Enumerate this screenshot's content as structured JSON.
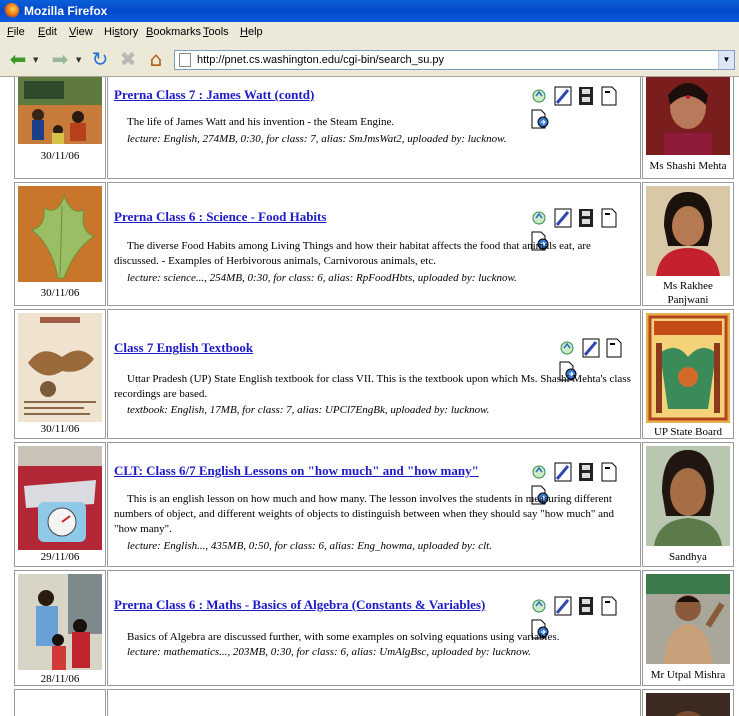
{
  "window": {
    "title": "Mozilla Firefox"
  },
  "menu": [
    {
      "label": "File",
      "key": "F",
      "rest": "ile"
    },
    {
      "label": "Edit",
      "key": "E",
      "rest": "dit"
    },
    {
      "label": "View",
      "key": "V",
      "rest": "iew"
    },
    {
      "label": "History",
      "key": "",
      "pre": "Hi",
      "key2": "s",
      "rest": "tory"
    },
    {
      "label": "Bookmarks",
      "key": "B",
      "rest": "ookmarks"
    },
    {
      "label": "Tools",
      "key": "T",
      "rest": "ools"
    },
    {
      "label": "Help",
      "key": "H",
      "rest": "elp"
    }
  ],
  "urlbar": {
    "url": "http://pnet.cs.washington.edu/cgi-bin/search_su.py"
  },
  "rows": [
    {
      "date": "30/11/06",
      "title": "Prerna Class 7 : James Watt (contd)",
      "description": "The life of James Watt and his invention - the Steam Engine.",
      "meta": "lecture: English, 274MB, 0:30, for class: 7, alias: SmJmsWat2, uploaded by: lucknow.",
      "person": "Ms Shashi Mehta",
      "has_video": true
    },
    {
      "date": "30/11/06",
      "title": "Prerna Class 6 : Science - Food Habits",
      "description": "The diverse Food Habits among Living Things and how their habitat affects the food that animals eat, are discussed. - Examples of Herbivorous animals, Carnivorous animals, etc.",
      "meta": "lecture: science..., 254MB, 0:30, for class: 6, alias: RpFoodHbts, uploaded by: lucknow.",
      "person": "Ms Rakhee Panjwani",
      "has_video": true
    },
    {
      "date": "30/11/06",
      "title": "Class 7 English Textbook",
      "description": "Uttar Pradesh (UP) State English textbook for class VII. This is the textbook upon which Ms. Shashi Mehta's class recordings are based.",
      "meta": "textbook: English, 17MB, for class: 7, alias: UPCl7EngBk, uploaded by: lucknow.",
      "person": "UP State Board",
      "has_video": false
    },
    {
      "date": "29/11/06",
      "title": "CLT: Class 6/7 English Lessons on \"how much\" and \"how many\"",
      "description": "This is an english lesson on how much and how many. The lesson involves the students in measuring different numbers of object, and different weights of objects to distinguish between when they should say \"how much\" and \"how many\".",
      "meta": "lecture: English..., 435MB, 0:50, for class: 6, alias: Eng_howma, uploaded by: clt.",
      "person": "Sandhya",
      "has_video": true
    },
    {
      "date": "28/11/06",
      "title": "Prerna Class 6 : Maths - Basics of Algebra (Constants & Variables)",
      "description": "Basics of Algebra are discussed further, with some examples on solving equations using variables.",
      "meta": "lecture: mathematics..., 203MB, 0:30, for class: 6, alias: UmAlgBsc, uploaded by: lucknow.",
      "person": "Mr Utpal Mishra",
      "has_video": true
    }
  ],
  "icons": [
    "recycle-icon",
    "edit-pencil-icon",
    "video-film-icon",
    "document-icon",
    "download-icon"
  ]
}
